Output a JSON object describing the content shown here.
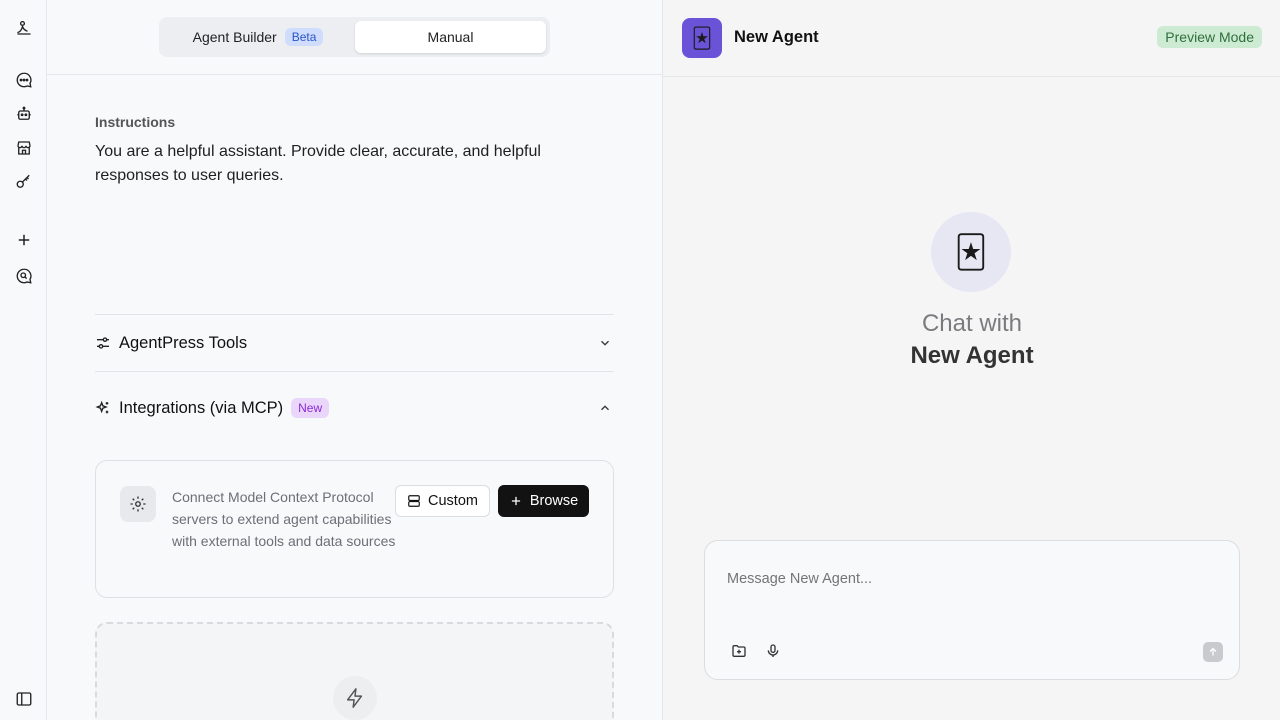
{
  "rail": {
    "items": [
      "logo-icon",
      "chat-icon",
      "agents-icon",
      "marketplace-icon",
      "key-icon",
      "plus-icon",
      "search-chat-icon",
      "sidebar-toggle-icon"
    ]
  },
  "mode_toggle": {
    "agent_builder_label": "Agent Builder",
    "beta_badge": "Beta",
    "manual_label": "Manual"
  },
  "instructions": {
    "label": "Instructions",
    "text": "You are a helpful assistant. Provide clear, accurate, and helpful responses to user queries."
  },
  "sections": {
    "agentpress_tools": "AgentPress Tools",
    "integrations": "Integrations (via MCP)",
    "integrations_badge": "New"
  },
  "mcp": {
    "description": "Connect Model Context Protocol servers to extend agent capabilities with external tools and data sources",
    "custom_button": "Custom",
    "browse_button": "Browse"
  },
  "preview": {
    "agent_name": "New Agent",
    "mode_badge": "Preview Mode",
    "avatar_emoji": "🃏",
    "chat_with": "Chat with",
    "chat_agent_name": "New Agent",
    "composer_placeholder": "Message New Agent..."
  },
  "colors": {
    "accent": "#6b53d8",
    "beta_badge_bg": "#cfdcfb",
    "new_badge_bg": "#ead6fb",
    "preview_badge_bg": "#cdebd3",
    "primary_button": "#121212"
  }
}
